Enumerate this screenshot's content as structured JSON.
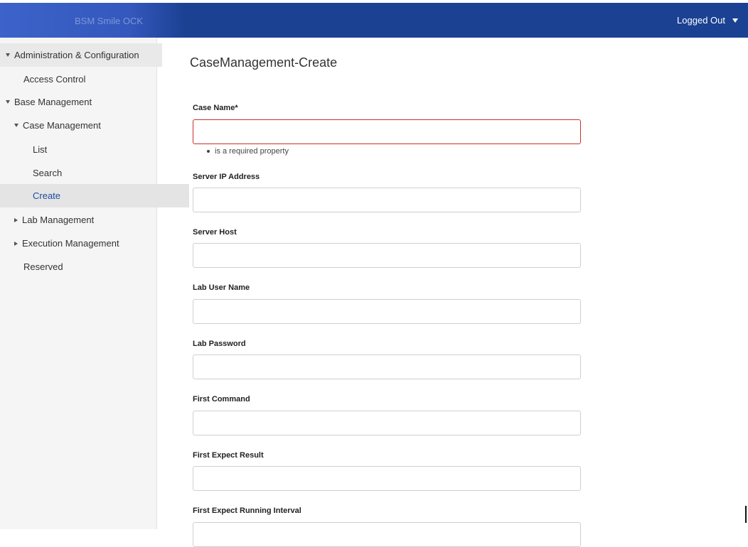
{
  "header": {
    "brand_text": "BSM Smile OCK",
    "user_status": "Logged Out",
    "bg_color": "#1b4193"
  },
  "sidebar": {
    "items": [
      {
        "label": "Administration & Configuration",
        "expanded": true
      },
      {
        "label": "Access Control"
      },
      {
        "label": "Base Management",
        "expanded": true
      },
      {
        "label": "Case Management",
        "expanded": true
      },
      {
        "label": "List"
      },
      {
        "label": "Search"
      },
      {
        "label": "Create",
        "active": true
      },
      {
        "label": "Lab Management",
        "expanded": false
      },
      {
        "label": "Execution Management",
        "expanded": false
      },
      {
        "label": "Reserved"
      }
    ]
  },
  "main": {
    "title": "CaseManagement-Create",
    "fields": [
      {
        "label": "Case Name*",
        "value": "",
        "error": "is a required property"
      },
      {
        "label": "Server IP Address",
        "value": ""
      },
      {
        "label": "Server Host",
        "value": ""
      },
      {
        "label": "Lab User Name",
        "value": ""
      },
      {
        "label": "Lab Password",
        "value": ""
      },
      {
        "label": "First Command",
        "value": ""
      },
      {
        "label": "First Expect Result",
        "value": ""
      },
      {
        "label": "First Expect Running Interval",
        "value": ""
      }
    ]
  },
  "colors": {
    "accent": "#1c4ba0",
    "error_border": "#c9302c"
  }
}
